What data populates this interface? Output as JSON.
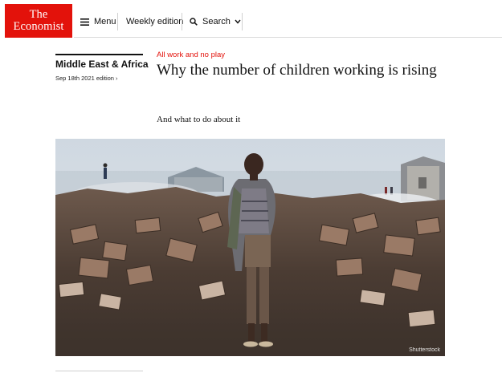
{
  "header": {
    "logo_line1": "The",
    "logo_line2": "Economist",
    "menu_label": "Menu",
    "weekly_label": "Weekly edition",
    "search_label": "Search"
  },
  "section": {
    "name": "Middle East & Africa",
    "edition": "Sep 18th 2021 edition ›"
  },
  "article": {
    "rubric": "All work and no play",
    "headline": "Why the number of children working is rising",
    "subhead": "And what to do about it"
  },
  "image": {
    "credit": "Shutterstock"
  },
  "colors": {
    "brand_red": "#e3120b",
    "text": "#111111"
  }
}
